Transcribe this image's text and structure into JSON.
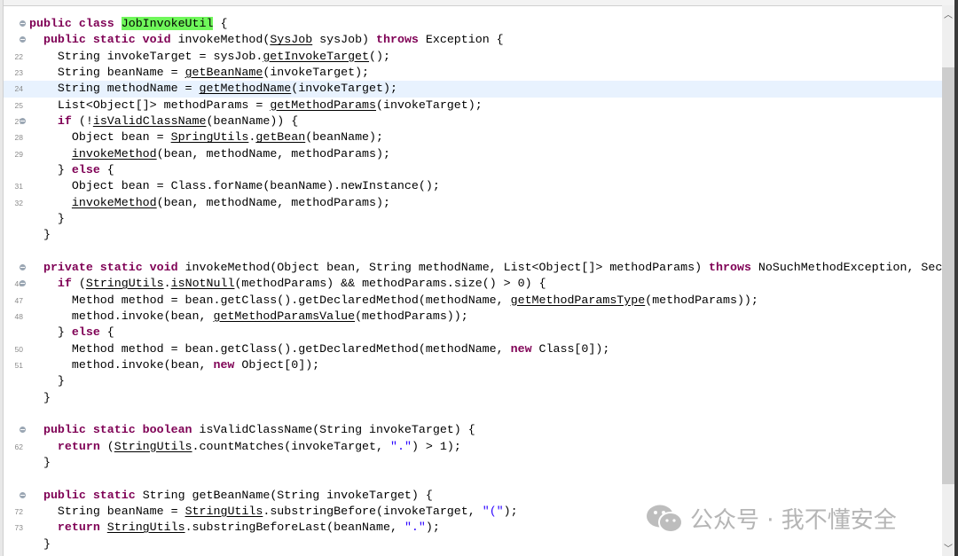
{
  "editor": {
    "highlight_color": "#e8f2fe",
    "keyword_color": "#7f0055",
    "string_color": "#2a00ff",
    "occurrence_color": "#6ff75a",
    "lines": [
      {
        "n": "",
        "fold": true,
        "t": [
          [
            "public class ",
            "k"
          ],
          [
            "JobInvokeUtil",
            "h"
          ],
          [
            " {",
            ""
          ]
        ]
      },
      {
        "n": "",
        "fold": true,
        "t": [
          [
            "  ",
            ""
          ],
          [
            "public static void ",
            "k"
          ],
          [
            "invokeMethod(",
            ""
          ],
          [
            "SysJob",
            "u"
          ],
          [
            " sysJob) ",
            ""
          ],
          [
            "throws ",
            "k"
          ],
          [
            "Exception {",
            ""
          ]
        ]
      },
      {
        "n": "22",
        "t": [
          [
            "    String invokeTarget = sysJob.",
            ""
          ],
          [
            "getInvokeTarget",
            "u"
          ],
          [
            "();",
            ""
          ]
        ]
      },
      {
        "n": "23",
        "t": [
          [
            "    String beanName = ",
            ""
          ],
          [
            "getBeanName",
            "u"
          ],
          [
            "(invokeTarget);",
            ""
          ]
        ]
      },
      {
        "n": "24",
        "current": true,
        "t": [
          [
            "    String methodName = ",
            ""
          ],
          [
            "getMethodName",
            "u"
          ],
          [
            "(invokeTarget);",
            ""
          ]
        ]
      },
      {
        "n": "25",
        "t": [
          [
            "    List<Object[]> methodParams = ",
            ""
          ],
          [
            "getMethodParams",
            "u"
          ],
          [
            "(invokeTarget);",
            ""
          ]
        ]
      },
      {
        "n": "27",
        "fold": true,
        "t": [
          [
            "    ",
            ""
          ],
          [
            "if ",
            "k"
          ],
          [
            "(!",
            ""
          ],
          [
            "isValidClassName",
            "u"
          ],
          [
            "(beanName)) {",
            ""
          ]
        ]
      },
      {
        "n": "28",
        "t": [
          [
            "      Object bean = ",
            ""
          ],
          [
            "SpringUtils",
            "u"
          ],
          [
            ".",
            ""
          ],
          [
            "getBean",
            "u"
          ],
          [
            "(beanName);",
            ""
          ]
        ]
      },
      {
        "n": "29",
        "t": [
          [
            "      ",
            ""
          ],
          [
            "invokeMethod",
            "u"
          ],
          [
            "(bean, methodName, methodParams);",
            ""
          ]
        ]
      },
      {
        "n": "",
        "t": [
          [
            "    } ",
            ""
          ],
          [
            "else ",
            "k"
          ],
          [
            "{",
            ""
          ]
        ]
      },
      {
        "n": "31",
        "t": [
          [
            "      Object bean = Class.forName(beanName).newInstance();",
            ""
          ]
        ]
      },
      {
        "n": "32",
        "t": [
          [
            "      ",
            ""
          ],
          [
            "invokeMethod",
            "u"
          ],
          [
            "(bean, methodName, methodParams);",
            ""
          ]
        ]
      },
      {
        "n": "",
        "t": [
          [
            "    }",
            ""
          ]
        ]
      },
      {
        "n": "",
        "t": [
          [
            "  }",
            ""
          ]
        ]
      },
      {
        "n": "",
        "t": []
      },
      {
        "n": "",
        "fold": true,
        "t": [
          [
            "  ",
            ""
          ],
          [
            "private static void ",
            "k"
          ],
          [
            "invokeMethod(Object bean, String methodName, List<Object[]> methodParams) ",
            ""
          ],
          [
            "throws ",
            "k"
          ],
          [
            "NoSuchMethodException, Secu",
            ""
          ]
        ]
      },
      {
        "n": "46",
        "fold": true,
        "t": [
          [
            "    ",
            ""
          ],
          [
            "if ",
            "k"
          ],
          [
            "(",
            ""
          ],
          [
            "StringUtils",
            "u"
          ],
          [
            ".",
            ""
          ],
          [
            "isNotNull",
            "u"
          ],
          [
            "(methodParams) && methodParams.size() > 0) {",
            ""
          ]
        ]
      },
      {
        "n": "47",
        "t": [
          [
            "      Method method = bean.getClass().getDeclaredMethod(methodName, ",
            ""
          ],
          [
            "getMethodParamsType",
            "u"
          ],
          [
            "(methodParams));",
            ""
          ]
        ]
      },
      {
        "n": "48",
        "t": [
          [
            "      method.invoke(bean, ",
            ""
          ],
          [
            "getMethodParamsValue",
            "u"
          ],
          [
            "(methodParams));",
            ""
          ]
        ]
      },
      {
        "n": "",
        "t": [
          [
            "    } ",
            ""
          ],
          [
            "else ",
            "k"
          ],
          [
            "{",
            ""
          ]
        ]
      },
      {
        "n": "50",
        "t": [
          [
            "      Method method = bean.getClass().getDeclaredMethod(methodName, ",
            ""
          ],
          [
            "new ",
            "k"
          ],
          [
            "Class[0]);",
            ""
          ]
        ]
      },
      {
        "n": "51",
        "t": [
          [
            "      method.invoke(bean, ",
            ""
          ],
          [
            "new ",
            "k"
          ],
          [
            "Object[0]);",
            ""
          ]
        ]
      },
      {
        "n": "",
        "t": [
          [
            "    }",
            ""
          ]
        ]
      },
      {
        "n": "",
        "t": [
          [
            "  }",
            ""
          ]
        ]
      },
      {
        "n": "",
        "t": []
      },
      {
        "n": "",
        "fold": true,
        "t": [
          [
            "  ",
            ""
          ],
          [
            "public static boolean ",
            "k"
          ],
          [
            "isValidClassName(String invokeTarget) {",
            ""
          ]
        ]
      },
      {
        "n": "62",
        "t": [
          [
            "    ",
            ""
          ],
          [
            "return ",
            "k"
          ],
          [
            "(",
            ""
          ],
          [
            "StringUtils",
            "u"
          ],
          [
            ".countMatches(invokeTarget, ",
            ""
          ],
          [
            "\".\"",
            "s"
          ],
          [
            ") > 1);",
            ""
          ]
        ]
      },
      {
        "n": "",
        "t": [
          [
            "  }",
            ""
          ]
        ]
      },
      {
        "n": "",
        "t": []
      },
      {
        "n": "",
        "fold": true,
        "t": [
          [
            "  ",
            ""
          ],
          [
            "public static ",
            "k"
          ],
          [
            "String getBeanName(String invokeTarget) {",
            ""
          ]
        ]
      },
      {
        "n": "72",
        "t": [
          [
            "    String beanName = ",
            ""
          ],
          [
            "StringUtils",
            "u"
          ],
          [
            ".substringBefore(invokeTarget, ",
            ""
          ],
          [
            "\"(\"",
            "s"
          ],
          [
            ");",
            ""
          ]
        ]
      },
      {
        "n": "73",
        "t": [
          [
            "    ",
            ""
          ],
          [
            "return ",
            "k"
          ],
          [
            "StringUtils",
            "u"
          ],
          [
            ".substringBeforeLast(beanName, ",
            ""
          ],
          [
            "\".\"",
            "s"
          ],
          [
            ");",
            ""
          ]
        ]
      },
      {
        "n": "",
        "t": [
          [
            "  }",
            ""
          ]
        ]
      }
    ]
  },
  "scrollbar": {
    "up_icon": "chevron-up-icon",
    "down_icon": "chevron-down-icon"
  },
  "watermark": {
    "text": "公众号 · 我不懂安全",
    "icon": "wechat-icon"
  }
}
